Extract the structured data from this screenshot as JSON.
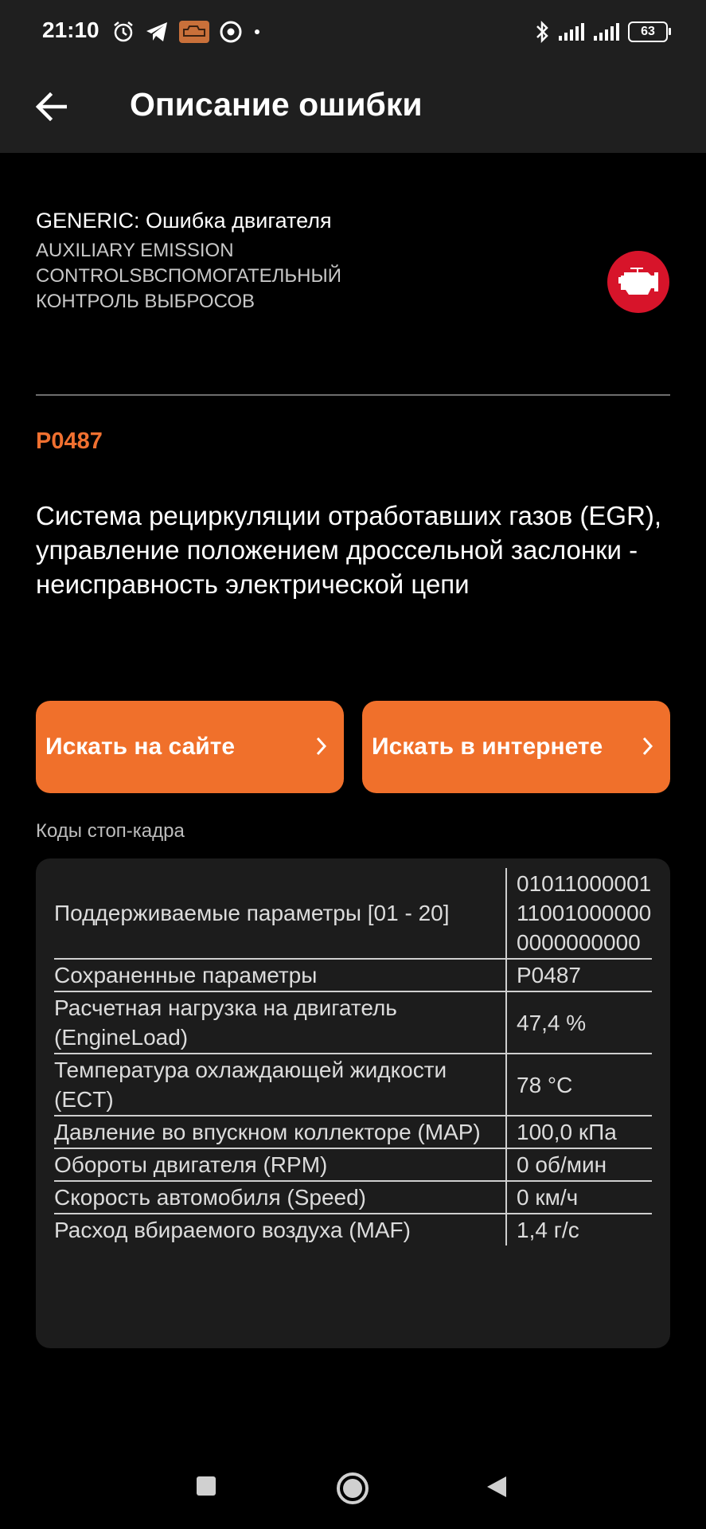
{
  "status_bar": {
    "time": "21:10",
    "left_icons": [
      "alarm-icon",
      "telegram-icon",
      "car-scanner-icon",
      "chrome-icon",
      "dot-icon"
    ],
    "right_icons": [
      "bluetooth-icon",
      "signal-icon",
      "signal-icon"
    ],
    "battery": "63"
  },
  "app_bar": {
    "title": "Описание ошибки",
    "back_icon": "back-arrow-icon"
  },
  "header": {
    "generic": "GENERIC: Ошибка двигателя",
    "category": "AUXILIARY EMISSION CONTROLSВСПОМОГАТЕЛЬНЫЙ КОНТРОЛЬ ВЫБРОСОВ",
    "icon": "check-engine-icon",
    "icon_color": "#d7142a"
  },
  "code": "P0487",
  "description": "Система рециркуляции отработавших газов (EGR), управление положением дроссельной заслонки - неисправность электрической цепи",
  "buttons": {
    "search_site": "Искать на сайте",
    "search_internet": "Искать в интернете"
  },
  "freeze_frame": {
    "label": "Коды стоп-кадра",
    "rows": [
      {
        "param": "Поддерживаемые параметры [01 - 20]",
        "value": "01011000001110010000000000000000"
      },
      {
        "param": "Сохраненные параметры",
        "value": "P0487"
      },
      {
        "param": "Расчетная нагрузка на двигатель (EngineLoad)",
        "value": "47,4 %"
      },
      {
        "param": "Температура охлаждающей жидкости (ECT)",
        "value": "78 °C"
      },
      {
        "param": "Давление во впускном коллекторе (MAP)",
        "value": "100,0 кПа"
      },
      {
        "param": "Обороты двигателя (RPM)",
        "value": "0 об/мин"
      },
      {
        "param": "Скорость автомобиля (Speed)",
        "value": "0 км/ч"
      },
      {
        "param": "Расход вбираемого воздуха (MAF)",
        "value": "1,4 г/с"
      }
    ]
  },
  "colors": {
    "accent": "#f0702b",
    "code": "#f07030",
    "background": "#000000",
    "bar": "#1f1f1f"
  },
  "nav": [
    "recents-icon",
    "home-icon",
    "back-icon"
  ]
}
